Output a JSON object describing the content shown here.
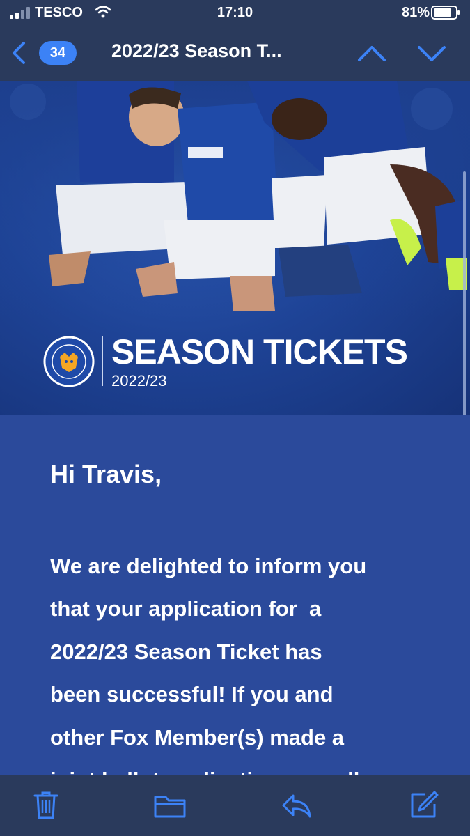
{
  "status_bar": {
    "carrier": "TESCO",
    "time": "17:10",
    "battery": "81%"
  },
  "nav": {
    "badge_count": "34",
    "title": "2022/23 Season T..."
  },
  "hero": {
    "title": "SEASON TICKETS",
    "subtitle": "2022/23",
    "logo_text": "LEICESTER CITY FOOTBALL CLUB"
  },
  "email": {
    "greeting": "Hi Travis,",
    "lines": [
      "We are delighted to inform you",
      "that your application for  a",
      "2022/23 Season Ticket has",
      "been successful! If you and",
      "other Fox Member(s) made a",
      "joint ballot application, you all"
    ]
  },
  "toolbar": {
    "items": [
      "trash-icon",
      "folder-icon",
      "reply-icon",
      "compose-icon"
    ]
  },
  "colors": {
    "accent": "#3c82f6",
    "bar": "#2a3a5c",
    "email_bg": "#2b4a9b"
  }
}
